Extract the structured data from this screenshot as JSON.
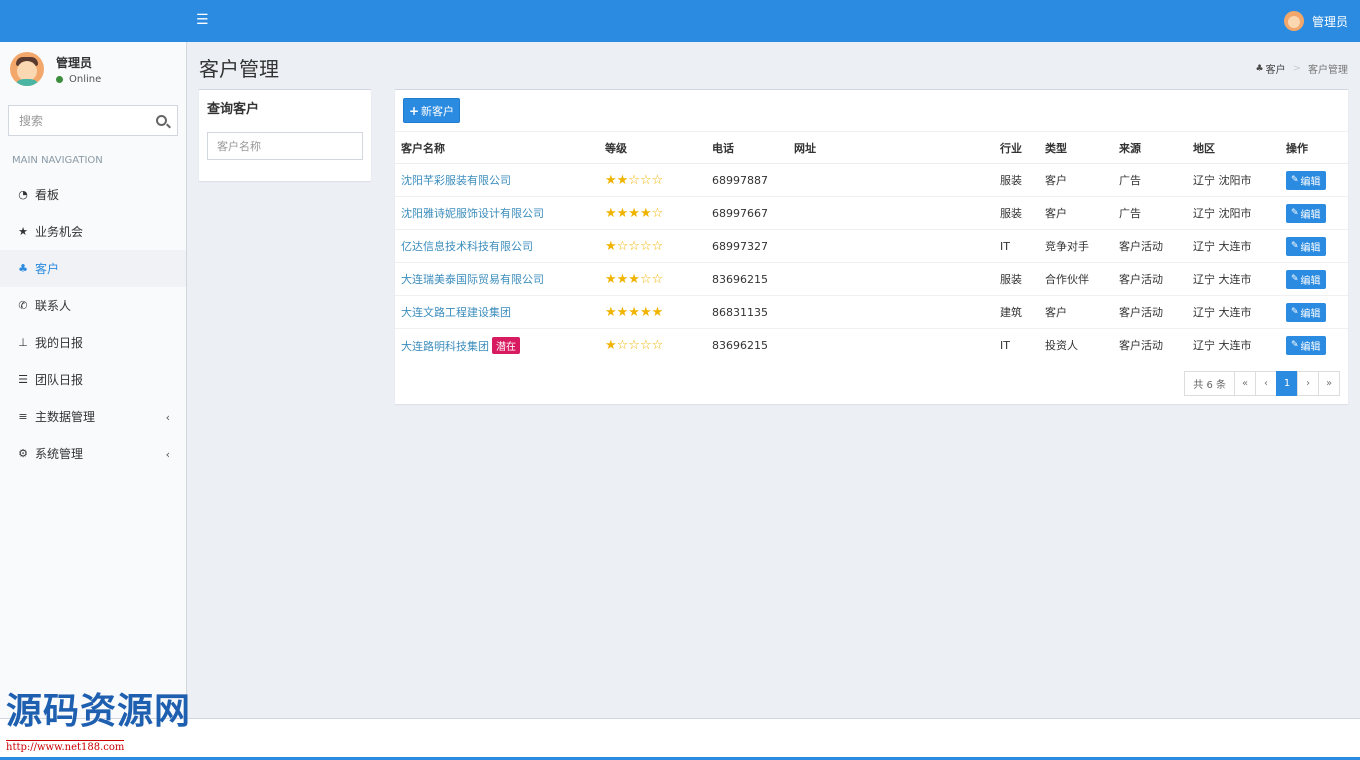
{
  "header": {
    "menu_icon": "bars-icon",
    "user_name": "管理员"
  },
  "sidebar": {
    "user": {
      "name": "管理员",
      "status": "Online"
    },
    "search_placeholder": "搜索",
    "nav_header": "MAIN NAVIGATION",
    "items": [
      {
        "label": "看板",
        "icon": "dashboard-icon"
      },
      {
        "label": "业务机会",
        "icon": "star-icon"
      },
      {
        "label": "客户",
        "icon": "sitemap-icon",
        "active": true
      },
      {
        "label": "联系人",
        "icon": "phone-icon"
      },
      {
        "label": "我的日报",
        "icon": "pin-icon"
      },
      {
        "label": "团队日报",
        "icon": "list-icon"
      },
      {
        "label": "主数据管理",
        "icon": "database-icon",
        "expandable": true
      },
      {
        "label": "系统管理",
        "icon": "cogs-icon",
        "expandable": true
      }
    ]
  },
  "page": {
    "title": "客户管理",
    "breadcrumb": [
      "客户",
      "客户管理"
    ]
  },
  "query": {
    "title": "查询客户",
    "placeholder": "客户名称"
  },
  "table": {
    "new_button": "新客户",
    "columns": [
      "客户名称",
      "等级",
      "电话",
      "网址",
      "行业",
      "类型",
      "来源",
      "地区",
      "操作"
    ],
    "rows": [
      {
        "name": "沈阳芊彩服装有限公司",
        "badge": "",
        "rating": 2,
        "phone": "68997887",
        "website": "",
        "industry": "服装",
        "type": "客户",
        "source": "广告",
        "region": "辽宁 沈阳市",
        "action": "编辑"
      },
      {
        "name": "沈阳雅诗妮服饰设计有限公司",
        "badge": "",
        "rating": 4,
        "phone": "68997667",
        "website": "",
        "industry": "服装",
        "type": "客户",
        "source": "广告",
        "region": "辽宁 沈阳市",
        "action": "编辑"
      },
      {
        "name": "亿达信息技术科技有限公司",
        "badge": "",
        "rating": 1,
        "phone": "68997327",
        "website": "",
        "industry": "IT",
        "type": "竞争对手",
        "source": "客户活动",
        "region": "辽宁 大连市",
        "action": "编辑"
      },
      {
        "name": "大连瑞美泰国际贸易有限公司",
        "badge": "",
        "rating": 3,
        "phone": "83696215",
        "website": "",
        "industry": "服装",
        "type": "合作伙伴",
        "source": "客户活动",
        "region": "辽宁 大连市",
        "action": "编辑"
      },
      {
        "name": "大连文路工程建设集团",
        "badge": "",
        "rating": 5,
        "phone": "86831135",
        "website": "",
        "industry": "建筑",
        "type": "客户",
        "source": "客户活动",
        "region": "辽宁 大连市",
        "action": "编辑"
      },
      {
        "name": "大连路明科技集团",
        "badge": "潜在",
        "rating": 1,
        "phone": "83696215",
        "website": "",
        "industry": "IT",
        "type": "投资人",
        "source": "客户活动",
        "region": "辽宁 大连市",
        "action": "编辑"
      }
    ]
  },
  "pagination": {
    "total": "共 6 条",
    "first": "«",
    "prev": "‹",
    "current": "1",
    "next": "›",
    "last": "»"
  },
  "watermark": {
    "text": "源码资源网",
    "url": "http://www.net188.com"
  },
  "colors": {
    "primary": "#2b8be0",
    "link": "#3c8dbc",
    "star": "#f0b400",
    "badge": "#d81b60",
    "online": "#3c8d3c"
  }
}
